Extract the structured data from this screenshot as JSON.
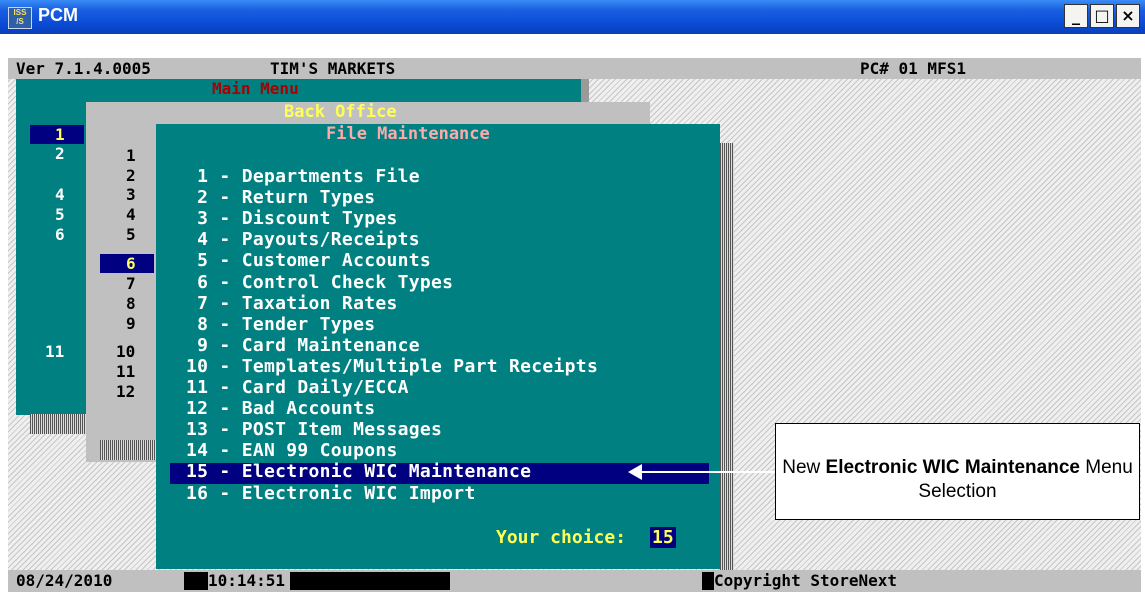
{
  "window": {
    "title": "PCM",
    "icon_text": "ISS\n/S",
    "buttons": {
      "minimize": "_",
      "maximize": "□",
      "close": "×"
    }
  },
  "header": {
    "version": "Ver 7.1.4.0005",
    "store": "TIM'S MARKETS",
    "pc": "PC# 01 MFS1"
  },
  "main_menu": {
    "title": "Main Menu",
    "numbers": [
      "1",
      "2",
      "4",
      "5",
      "6",
      "11"
    ],
    "selected": "1"
  },
  "back_office": {
    "title": "Back Office",
    "numbers": [
      "1",
      "2",
      "3",
      "4",
      "5",
      "6",
      "7",
      "8",
      "9",
      "10",
      "11",
      "12"
    ],
    "selected": "6"
  },
  "file_maintenance": {
    "title": "File Maintenance",
    "items": [
      {
        "num": " 1",
        "label": "Departments File"
      },
      {
        "num": " 2",
        "label": "Return Types"
      },
      {
        "num": " 3",
        "label": "Discount Types"
      },
      {
        "num": " 4",
        "label": "Payouts/Receipts"
      },
      {
        "num": " 5",
        "label": "Customer Accounts"
      },
      {
        "num": " 6",
        "label": "Control Check Types"
      },
      {
        "num": " 7",
        "label": "Taxation Rates"
      },
      {
        "num": " 8",
        "label": "Tender Types"
      },
      {
        "num": " 9",
        "label": "Card Maintenance"
      },
      {
        "num": "10",
        "label": "Templates/Multiple Part Receipts"
      },
      {
        "num": "11",
        "label": "Card Daily/ECCA"
      },
      {
        "num": "12",
        "label": "Bad Accounts"
      },
      {
        "num": "13",
        "label": "POST Item Messages"
      },
      {
        "num": "14",
        "label": "EAN 99 Coupons"
      },
      {
        "num": "15",
        "label": "Electronic WIC Maintenance"
      },
      {
        "num": "16",
        "label": "Electronic WIC Import"
      }
    ],
    "selected_index": 14,
    "choice_label": "Your choice:",
    "choice_value": "15"
  },
  "status": {
    "date": "08/24/2010",
    "time": "10:14:51",
    "copyright": "Copyright StoreNext"
  },
  "callout": {
    "pre": "New ",
    "bold": "Electronic WIC Maintenance",
    "post": " Menu Selection"
  },
  "colors": {
    "teal": "#008080",
    "navy": "#000080",
    "yellow": "#ffff55",
    "red": "#aa0000"
  }
}
